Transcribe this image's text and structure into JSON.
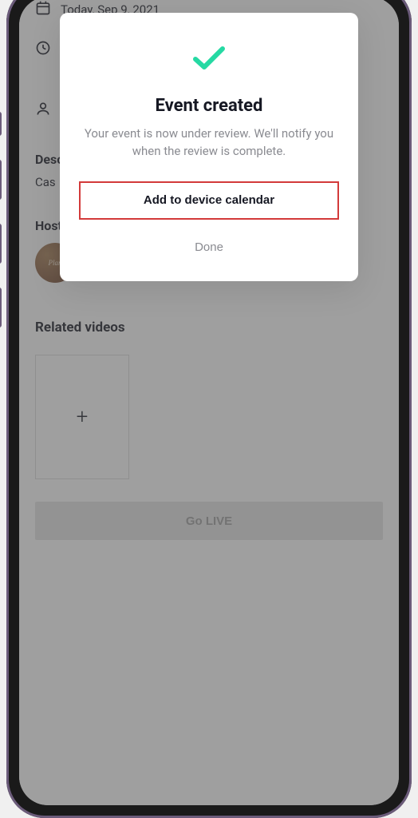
{
  "header": {
    "date_text": "Today, Sep 9, 2021"
  },
  "sections": {
    "description_label": "Description",
    "description_value": "Cas",
    "host_label": "Host",
    "host_avatar_text": "Plan",
    "related_label": "Related videos"
  },
  "buttons": {
    "go_live": "Go LIVE"
  },
  "modal": {
    "title": "Event created",
    "body": "Your event is now under review. We'll notify you when the review is complete.",
    "add_calendar": "Add to device calendar",
    "done": "Done"
  },
  "colors": {
    "accent_green": "#25D9A3",
    "highlight_red": "#d33a3a"
  }
}
